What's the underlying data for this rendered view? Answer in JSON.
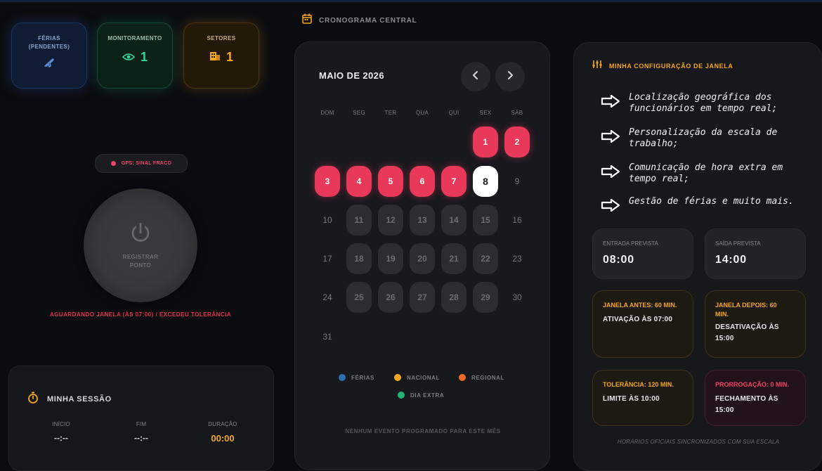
{
  "stats": {
    "ferias": {
      "label": "FÉRIAS (PENDENTES)",
      "icon": "plane-icon"
    },
    "monitoramento": {
      "label": "MONITORAMENTO",
      "value": "1",
      "icon": "eye-icon"
    },
    "setores": {
      "label": "SETORES",
      "value": "1",
      "icon": "building-icon"
    }
  },
  "gps": {
    "label": "GPS: SINAL FRACO"
  },
  "power_button": {
    "label": "REGISTRAR PONTO"
  },
  "status_message": "AGUARDANDO JANELA (ÀS 07:00) / EXCEDEU TOLERÂNCIA",
  "session": {
    "title": "MINHA SESSÃO",
    "inicio_label": "INÍCIO",
    "inicio_value": "--:--",
    "fim_label": "FIM",
    "fim_value": "--:--",
    "duracao_label": "DURAÇÃO",
    "duracao_value": "00:00"
  },
  "cronograma": {
    "title": "CRONOGRAMA CENTRAL",
    "month": "MAIO DE 2026",
    "weekdays": [
      "DOM",
      "SEG",
      "TER",
      "QUA",
      "QUI",
      "SEX",
      "SÁB"
    ],
    "days": [
      {
        "d": "1",
        "s": "red"
      },
      {
        "d": "2",
        "s": "red"
      },
      {
        "d": "3",
        "s": "red"
      },
      {
        "d": "4",
        "s": "red"
      },
      {
        "d": "5",
        "s": "red"
      },
      {
        "d": "6",
        "s": "red"
      },
      {
        "d": "7",
        "s": "red"
      },
      {
        "d": "8",
        "s": "today"
      },
      {
        "d": "9",
        "s": "plain"
      },
      {
        "d": "10",
        "s": "plain"
      },
      {
        "d": "11",
        "s": "grey"
      },
      {
        "d": "12",
        "s": "grey"
      },
      {
        "d": "13",
        "s": "grey"
      },
      {
        "d": "14",
        "s": "grey"
      },
      {
        "d": "15",
        "s": "grey"
      },
      {
        "d": "16",
        "s": "plain"
      },
      {
        "d": "17",
        "s": "plain"
      },
      {
        "d": "18",
        "s": "grey"
      },
      {
        "d": "19",
        "s": "grey"
      },
      {
        "d": "20",
        "s": "grey"
      },
      {
        "d": "21",
        "s": "grey"
      },
      {
        "d": "22",
        "s": "grey"
      },
      {
        "d": "23",
        "s": "plain"
      },
      {
        "d": "24",
        "s": "plain"
      },
      {
        "d": "25",
        "s": "grey"
      },
      {
        "d": "26",
        "s": "grey"
      },
      {
        "d": "27",
        "s": "grey"
      },
      {
        "d": "28",
        "s": "grey"
      },
      {
        "d": "29",
        "s": "grey"
      },
      {
        "d": "30",
        "s": "plain"
      },
      {
        "d": "31",
        "s": "plain"
      }
    ],
    "first_weekday_index": 5,
    "legend": [
      {
        "label": "FÉRIAS",
        "color": "#2f6fb0"
      },
      {
        "label": "NACIONAL",
        "color": "#f5a623"
      },
      {
        "label": "REGIONAL",
        "color": "#f06a2a"
      },
      {
        "label": "DIA EXTRA",
        "color": "#22b573"
      }
    ],
    "empty_message": "NENHUM EVENTO PROGRAMADO PARA ESTE MÊS"
  },
  "config": {
    "title": "MINHA CONFIGURAÇÃO DE JANELA",
    "features": [
      "Localização geográfica dos funcionários em tempo real;",
      "Personalização da escala de trabalho;",
      "Comunicação de hora extra em tempo real;",
      "Gestão de férias e muito mais."
    ],
    "entrada_label": "ENTRADA PREVISTA",
    "entrada_value": "08:00",
    "saida_label": "SAÍDA PREVISTA",
    "saida_value": "14:00",
    "janela_antes_label": "JANELA ANTES: 60 MIN.",
    "janela_antes_value": "ATIVAÇÃO ÀS 07:00",
    "janela_depois_label": "JANELA DEPOIS: 60 MIN.",
    "janela_depois_value": "DESATIVAÇÃO ÀS 15:00",
    "tolerancia_label": "TOLERÂNCIA: 120 MIN.",
    "tolerancia_value": "LIMITE ÀS 10:00",
    "prorrogacao_label": "PRORROGAÇÃO: 0 MIN.",
    "prorrogacao_value": "FECHAMENTO ÀS 15:00",
    "footer": "HORÁRIOS OFICIAIS SINCRONIZADOS COM SUA ESCALA"
  },
  "colors": {
    "accent_red": "#e8395a",
    "accent_orange": "#f5a623",
    "accent_green": "#34d399",
    "accent_blue": "#5b8fd6"
  }
}
